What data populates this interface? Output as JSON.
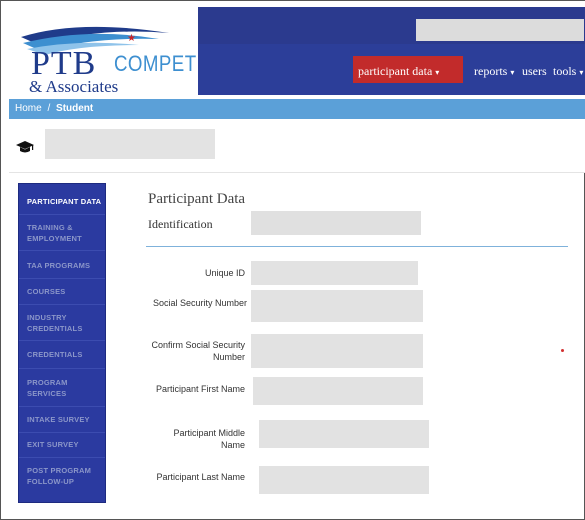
{
  "logo": {
    "ptb": "PTB",
    "compete": "COMPETE",
    "associates": "& Associates"
  },
  "nav": {
    "items": [
      {
        "label": "participant data"
      },
      {
        "label": "reports"
      },
      {
        "label": "users"
      },
      {
        "label": "tools"
      }
    ]
  },
  "breadcrumb": {
    "home": "Home",
    "separator": "/",
    "current": "Student"
  },
  "sidebar": {
    "items": [
      {
        "label": "PARTICIPANT DATA"
      },
      {
        "label": "TRAINING &"
      },
      {
        "label": "EMPLOYMENT"
      },
      {
        "label": "TAA PROGRAMS"
      },
      {
        "label": "COURSES"
      },
      {
        "label": "INDUSTRY"
      },
      {
        "label": "CREDENTIALS"
      },
      {
        "label": "CREDENTIALS"
      },
      {
        "label": "PROGRAM"
      },
      {
        "label": "SERVICES"
      },
      {
        "label": "INTAKE SURVEY"
      },
      {
        "label": "EXIT SURVEY"
      },
      {
        "label": "POST PROGRAM"
      },
      {
        "label": "FOLLOW-UP"
      }
    ]
  },
  "main": {
    "title": "Participant Data",
    "section": "Identification",
    "fields": [
      {
        "label": "Unique ID"
      },
      {
        "label": "Social Security Number"
      },
      {
        "label": "Confirm Social Security"
      },
      {
        "label": "Number"
      },
      {
        "label": "Participant First Name"
      },
      {
        "label": "Participant Middle"
      },
      {
        "label": "Name"
      },
      {
        "label": "Participant Last Name"
      }
    ]
  },
  "colors": {
    "navy": "#2b3a8e",
    "active_red": "#c22b2b",
    "breadcrumb_blue": "#5ba0d8",
    "sidebar_blue": "#2b3aa0"
  }
}
